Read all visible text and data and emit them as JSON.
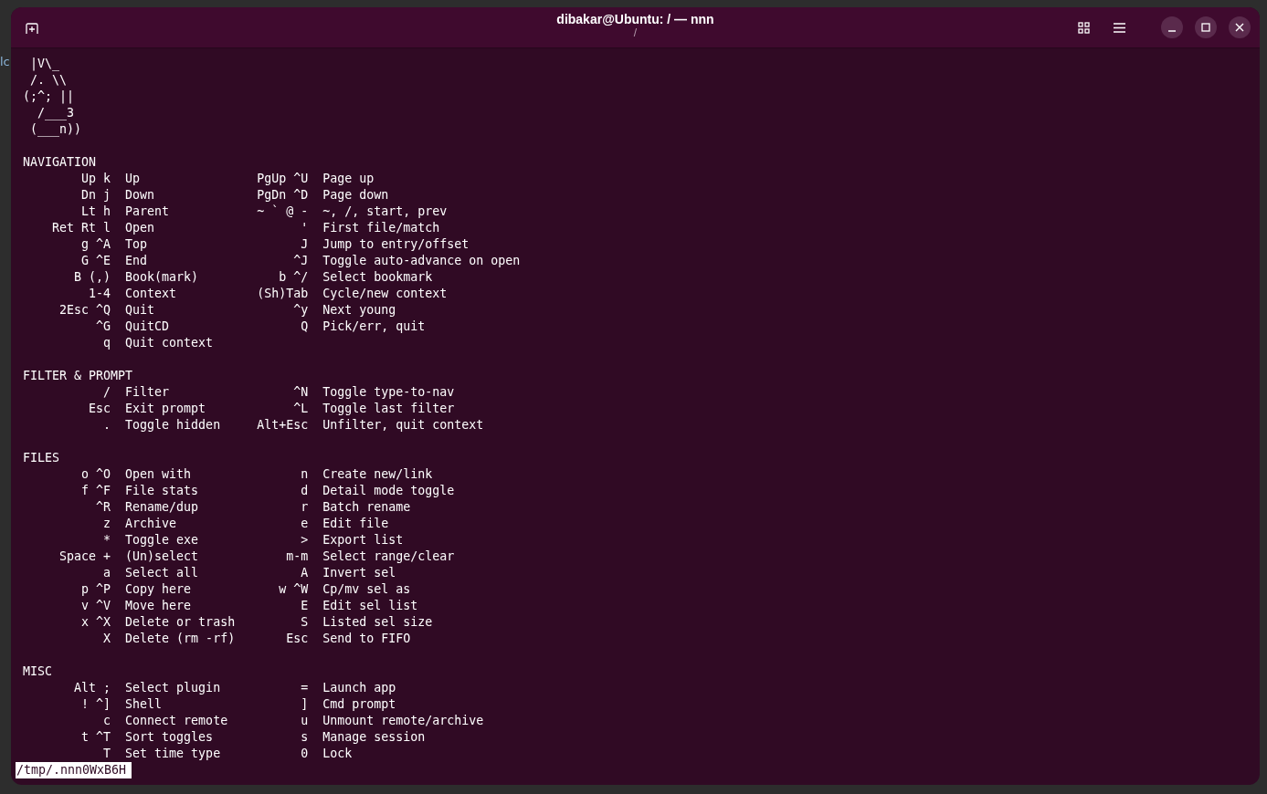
{
  "background_window": {
    "text": "lc"
  },
  "window": {
    "title": "dibakar@Ubuntu: / — nnn",
    "subtitle": "/"
  },
  "ascii_art": [
    " |V\\_",
    " /. \\\\",
    "(;^; ||",
    "  /___3",
    " (___n))"
  ],
  "sections": [
    {
      "title": "NAVIGATION",
      "rows": [
        {
          "key1": "Up k",
          "desc1": "Up",
          "key2": "PgUp ^U",
          "desc2": "Page up"
        },
        {
          "key1": "Dn j",
          "desc1": "Down",
          "key2": "PgDn ^D",
          "desc2": "Page down"
        },
        {
          "key1": "Lt h",
          "desc1": "Parent",
          "key2": "~ ` @ -",
          "desc2": "~, /, start, prev"
        },
        {
          "key1": "Ret Rt l",
          "desc1": "Open",
          "key2": "'",
          "desc2": "First file/match"
        },
        {
          "key1": "g ^A",
          "desc1": "Top",
          "key2": "J",
          "desc2": "Jump to entry/offset"
        },
        {
          "key1": "G ^E",
          "desc1": "End",
          "key2": "^J",
          "desc2": "Toggle auto-advance on open"
        },
        {
          "key1": "B (,)",
          "desc1": "Book(mark)",
          "key2": "b ^/",
          "desc2": "Select bookmark"
        },
        {
          "key1": "1-4",
          "desc1": "Context",
          "key2": "(Sh)Tab",
          "desc2": "Cycle/new context"
        },
        {
          "key1": "2Esc ^Q",
          "desc1": "Quit",
          "key2": "^y",
          "desc2": "Next young"
        },
        {
          "key1": "^G",
          "desc1": "QuitCD",
          "key2": "Q",
          "desc2": "Pick/err, quit"
        },
        {
          "key1": "q",
          "desc1": "Quit context"
        }
      ]
    },
    {
      "title": "FILTER & PROMPT",
      "rows": [
        {
          "key1": "/",
          "desc1": "Filter",
          "key2": "^N",
          "desc2": "Toggle type-to-nav"
        },
        {
          "key1": "Esc",
          "desc1": "Exit prompt",
          "key2": "^L",
          "desc2": "Toggle last filter"
        },
        {
          "key1": ".",
          "desc1": "Toggle hidden",
          "key2": "Alt+Esc",
          "desc2": "Unfilter, quit context"
        }
      ]
    },
    {
      "title": "FILES",
      "rows": [
        {
          "key1": "o ^O",
          "desc1": "Open with",
          "key2": "n",
          "desc2": "Create new/link"
        },
        {
          "key1": "f ^F",
          "desc1": "File stats",
          "key2": "d",
          "desc2": "Detail mode toggle"
        },
        {
          "key1": "^R",
          "desc1": "Rename/dup",
          "key2": "r",
          "desc2": "Batch rename"
        },
        {
          "key1": "z",
          "desc1": "Archive",
          "key2": "e",
          "desc2": "Edit file"
        },
        {
          "key1": "*",
          "desc1": "Toggle exe",
          "key2": ">",
          "desc2": "Export list"
        },
        {
          "key1": "Space +",
          "desc1": "(Un)select",
          "key2": "m-m",
          "desc2": "Select range/clear"
        },
        {
          "key1": "a",
          "desc1": "Select all",
          "key2": "A",
          "desc2": "Invert sel"
        },
        {
          "key1": "p ^P",
          "desc1": "Copy here",
          "key2": "w ^W",
          "desc2": "Cp/mv sel as"
        },
        {
          "key1": "v ^V",
          "desc1": "Move here",
          "key2": "E",
          "desc2": "Edit sel list"
        },
        {
          "key1": "x ^X",
          "desc1": "Delete or trash",
          "key2": "S",
          "desc2": "Listed sel size"
        },
        {
          "key1": "X",
          "desc1": "Delete (rm -rf)",
          "key2": "Esc",
          "desc2": "Send to FIFO"
        }
      ]
    },
    {
      "title": "MISC",
      "rows": [
        {
          "key1": "Alt ;",
          "desc1": "Select plugin",
          "key2": "=",
          "desc2": "Launch app"
        },
        {
          "key1": "! ^]",
          "desc1": "Shell",
          "key2": "]",
          "desc2": "Cmd prompt"
        },
        {
          "key1": "c",
          "desc1": "Connect remote",
          "key2": "u",
          "desc2": "Unmount remote/archive"
        },
        {
          "key1": "t ^T",
          "desc1": "Sort toggles",
          "key2": "s",
          "desc2": "Manage session"
        },
        {
          "key1": "T",
          "desc1": "Set time type",
          "key2": "0",
          "desc2": "Lock"
        }
      ]
    }
  ],
  "status_line": "/tmp/.nnn0WxB6H"
}
